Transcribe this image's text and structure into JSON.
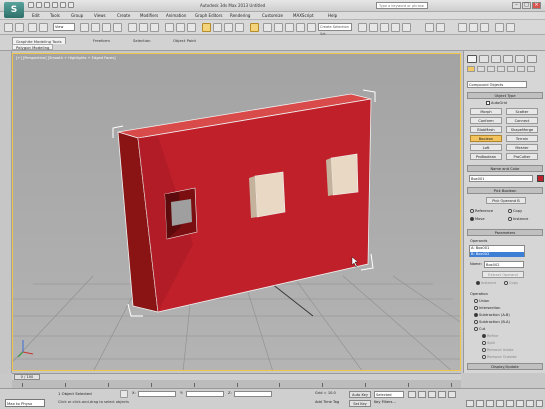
{
  "app": {
    "logo": "S",
    "title": "Autodesk 3ds Max 2013    Untitled",
    "search_placeholder": "Type a keyword or phrase"
  },
  "window_controls": [
    "–",
    "□",
    "×"
  ],
  "menu": [
    "Edit",
    "Tools",
    "Group",
    "Views",
    "Create",
    "Modifiers",
    "Animation",
    "Graph Editors",
    "Rendering",
    "Customize",
    "MAXScript",
    "Help"
  ],
  "toolbar": {
    "reference_coord": "View",
    "named_selection": "Create Selection Set"
  },
  "ribbon": {
    "tabs": [
      "Graphite Modeling Tools",
      "Freeform",
      "Selection",
      "Object Paint"
    ],
    "sub_tab": "Polygon Modeling"
  },
  "viewport": {
    "label": "[+] [Perspective] [Smooth + Highlights + Edged Faces]",
    "object_color": "#c0202a",
    "frame_color": "#f0c54a"
  },
  "command_panel": {
    "category": "Compound Objects",
    "object_type_title": "Object Type",
    "autogrid": "AutoGrid",
    "object_buttons": [
      [
        "Morph",
        "Scatter"
      ],
      [
        "Conform",
        "Connect"
      ],
      [
        "BlobMesh",
        "ShapeMerge"
      ],
      [
        "Boolean",
        "Terrain"
      ],
      [
        "Loft",
        "Mesher"
      ],
      [
        "ProBoolean",
        "ProCutter"
      ]
    ],
    "active_button": "Boolean",
    "name_color_title": "Name and Color",
    "object_name": "Box001",
    "pick_boolean_title": "Pick Boolean",
    "pick_operand": "Pick Operand B",
    "pick_modes": [
      "Reference",
      "Copy",
      "Move",
      "Instance"
    ],
    "parameters_title": "Parameters",
    "operands_label": "Operands",
    "operands": [
      "A: Box001",
      "B: Box002"
    ],
    "name_label": "Name:",
    "name_value": "Box002",
    "extract_operand": "Extract Operand",
    "extract_modes": [
      "Instance",
      "Copy"
    ],
    "operation_label": "Operation",
    "operations": [
      "Union",
      "Intersection",
      "Subtraction (A-B)",
      "Subtraction (B-A)",
      "Cut"
    ],
    "cut_modes": [
      "Refine",
      "Split",
      "Remove Inside",
      "Remove Outside"
    ],
    "display_update_title": "Display/Update",
    "display_label": "Display:",
    "display_modes": [
      "Result",
      "Operands"
    ]
  },
  "timeline": {
    "slider": "0 / 100",
    "ticks": [
      "0",
      "10",
      "20",
      "30",
      "40",
      "50",
      "60",
      "70",
      "80",
      "90",
      "100"
    ]
  },
  "status": {
    "script_listener": "Max to Physx",
    "selection": "1 Object Selected",
    "prompt": "Click or click-and-drag to select objects",
    "x_label": "X:",
    "y_label": "Y:",
    "z_label": "Z:",
    "grid": "Grid = 10.0",
    "add_time_tag": "Add Time Tag",
    "auto_key": "Auto Key",
    "set_key": "Set Key",
    "selected_drop": "Selected",
    "key_filters": "Key Filters..."
  }
}
